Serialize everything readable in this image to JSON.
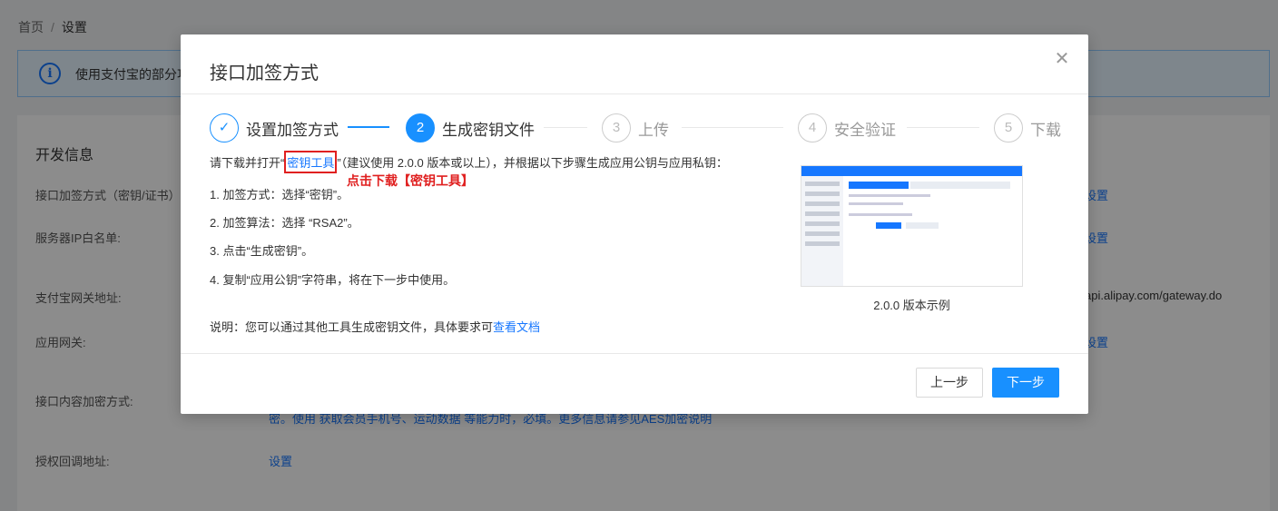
{
  "breadcrumb": {
    "home": "首页",
    "separator": "/",
    "current": "设置"
  },
  "alert": {
    "icon": "info-icon",
    "text": "使用支付宝的部分功"
  },
  "background": {
    "card_title": "开发信息",
    "rows": [
      {
        "label": "接口加签方式（密钥/证书）:",
        "right": "设置"
      },
      {
        "label": "服务器IP白名单:",
        "right": "设置"
      },
      {
        "label": "支付宝网关地址:",
        "right": "api.alipay.com/gateway.do"
      },
      {
        "label": "应用网关:",
        "right": "设置"
      },
      {
        "label": "接口内容加密方式:",
        "note": "密。使用 获取会员手机号、运动数据 等能力时，必填。更多信息请参见AES加密说明"
      },
      {
        "label": "授权回调地址:",
        "value": "设置"
      }
    ]
  },
  "modal": {
    "title": "接口加签方式",
    "close_icon": "close-icon",
    "steps": [
      {
        "num": "✓",
        "label": "设置加签方式",
        "state": "done"
      },
      {
        "num": "2",
        "label": "生成密钥文件",
        "state": "active"
      },
      {
        "num": "3",
        "label": "上传",
        "state": "pending"
      },
      {
        "num": "4",
        "label": "安全验证",
        "state": "pending"
      },
      {
        "num": "5",
        "label": "下载",
        "state": "pending"
      }
    ],
    "intro_prefix": "请下载并打开“",
    "intro_link": "密钥工具",
    "intro_suffix": "”（建议使用 2.0.0 版本或以上），并根据以下步骤生成应用公钥与应用私钥：",
    "annotation": "点击下载【密钥工具】",
    "instructions": [
      "1. 加签方式：选择“密钥”。",
      "2. 加签算法：选择 “RSA2”。",
      "3. 点击“生成密钥”。",
      "4. 复制“应用公钥”字符串，将在下一步中使用。"
    ],
    "note_prefix": "说明：您可以通过其他工具生成密钥文件，具体要求可",
    "note_link": "查看文档",
    "preview_caption": "2.0.0 版本示例",
    "prev_button": "上一步",
    "next_button": "下一步"
  }
}
